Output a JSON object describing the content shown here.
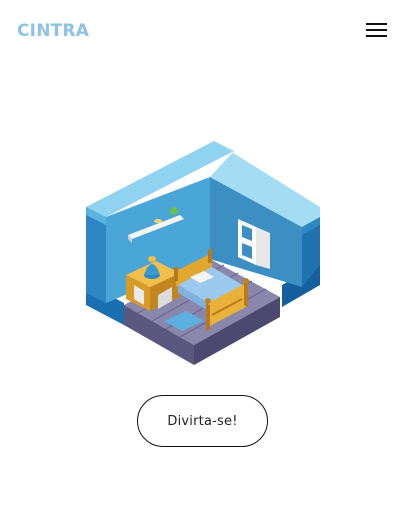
{
  "header": {
    "logo_text": "CINTRA",
    "menu_icon": "hamburger-menu-icon"
  },
  "hero": {
    "illustration_icon": "isometric-bedroom-illustration",
    "cta_label": "Divirta-se!"
  },
  "colors": {
    "brand": "#8ec2e6",
    "wall": "#3a9ad0",
    "wall_top": "#9ed8f2",
    "floor": "#7d7aa0",
    "wood": "#e0a830"
  }
}
